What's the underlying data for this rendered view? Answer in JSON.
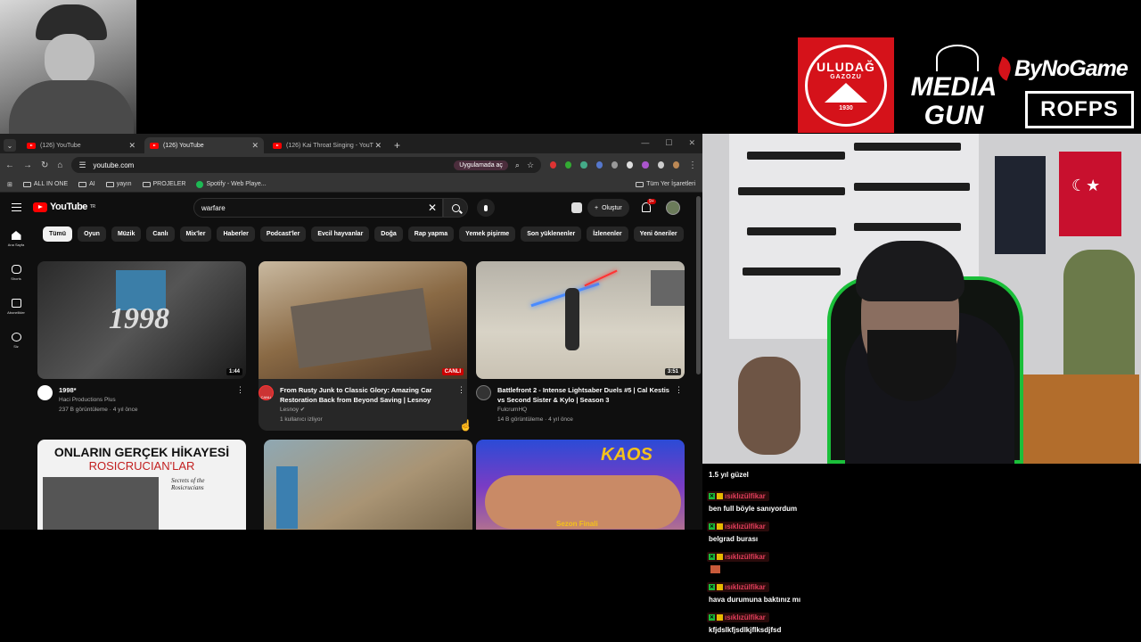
{
  "browser": {
    "tabs": [
      {
        "title": "(126) YouTube",
        "active": false
      },
      {
        "title": "(126) YouTube",
        "active": true
      },
      {
        "title": "(126) Kai Throat Singing - YouT",
        "active": false
      }
    ],
    "url": "youtube.com",
    "open_in_app": "Uygulamada aç",
    "bookmarks": [
      "ALL IN ONE",
      "AI",
      "yayın",
      "PROJELER",
      "Spotify - Web Playe..."
    ],
    "all_bookmarks": "Tüm Yer İşaretleri"
  },
  "youtube": {
    "region": "TR",
    "logo_text": "YouTube",
    "search_query": "warfare",
    "create_label": "Oluştur",
    "notif_count": "9+",
    "sidebar": [
      {
        "label": "Ana Sayfa",
        "icon": "home-icon"
      },
      {
        "label": "Shorts",
        "icon": "shorts-icon"
      },
      {
        "label": "Abonelikler",
        "icon": "subscriptions-icon"
      },
      {
        "label": "Siz",
        "icon": "you-icon"
      }
    ],
    "chips": [
      "Tümü",
      "Oyun",
      "Müzik",
      "Canlı",
      "Mix'ler",
      "Haberler",
      "Podcast'ler",
      "Evcil hayvanlar",
      "Doğa",
      "Rap yapma",
      "Yemek pişirme",
      "Son yüklenenler",
      "İzlenenler",
      "Yeni öneriler"
    ],
    "videos": [
      {
        "title": "1998*",
        "channel": "Haci Productions Plus",
        "stats": "237 B görüntüleme · 4 yıl önce",
        "duration": "1:44",
        "thumb_text": "1998"
      },
      {
        "title": "From Rusty Junk to Classic Glory: Amazing Car Restoration Back from Beyond Saving | Lesnoy",
        "channel": "Lesnoy",
        "stats": "1 kullanıcı izliyor",
        "live": "CANLI",
        "avatar_badge": "CANLI"
      },
      {
        "title": "Battlefront 2 - Intense Lightsaber Duels #5 | Cal Kestis vs Second Sister & Kylo | Season 3",
        "channel": "FulcrumHQ",
        "stats": "14 B görüntüleme · 4 yıl önce",
        "duration": "3:51"
      },
      {
        "thumb_line1": "ONLARIN GERÇEK HİKAYESİ",
        "thumb_line2": "ROSICRUCIAN'LAR",
        "thumb_line3": "Secrets of the Rosicrucians"
      },
      {},
      {
        "thumb_text": "KAOS",
        "thumb_sub": "Sezon Finali"
      }
    ]
  },
  "overlay": {
    "sponsors": {
      "uludag": {
        "name": "ULUDAĞ",
        "sub": "GAZOZU",
        "year": "1930"
      },
      "mediagun": {
        "line1": "MEDIA",
        "line2": "GUN"
      },
      "bynogame": "ByNoGame",
      "rofps": "ROFPS"
    },
    "chat_partial_first": "1.5 yıl güzel",
    "chat": [
      {
        "user": "ısıklızülfikar",
        "text": "ben full böyle sanıyordum"
      },
      {
        "user": "ısıklızülfikar",
        "text": "belgrad burası"
      },
      {
        "user": "ısıklızülfikar",
        "text": "",
        "emote": true
      },
      {
        "user": "ısıklızülfikar",
        "text": "hava durumuna baktınız mı"
      },
      {
        "user": "ısıklızülfikar",
        "text": "kfjdslkfjsdlkjflksdjfsd"
      }
    ]
  }
}
